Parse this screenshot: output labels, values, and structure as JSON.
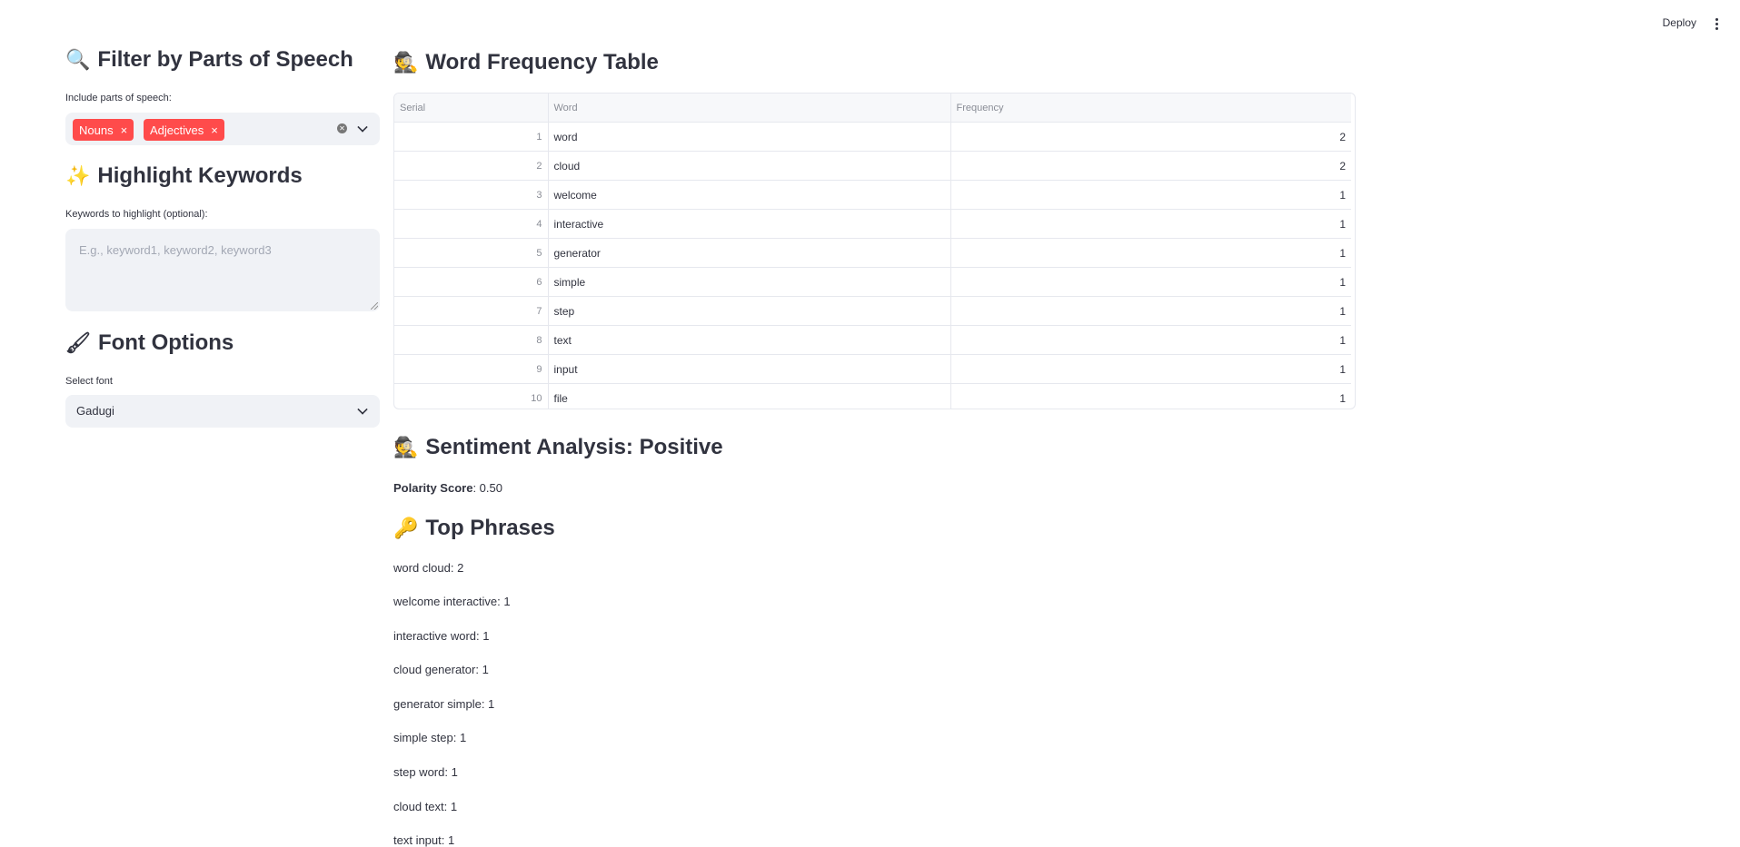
{
  "toolbar": {
    "deploy_label": "Deploy"
  },
  "sidebar": {
    "pos_section": {
      "emoji": "🔍",
      "title": "Filter by Parts of Speech",
      "label": "Include parts of speech:",
      "tags": [
        "Nouns",
        "Adjectives"
      ],
      "tag_remove_glyph": "×"
    },
    "highlight_section": {
      "emoji": "✨",
      "title": "Highlight Keywords",
      "label": "Keywords to highlight (optional):",
      "placeholder": "E.g., keyword1, keyword2, keyword3"
    },
    "font_section": {
      "emoji": "🖌",
      "title": "Font Options",
      "label": "Select font",
      "selected": "Gadugi"
    }
  },
  "main": {
    "table_section": {
      "emoji": "🕵",
      "title": "Word Frequency Table",
      "columns": [
        "Serial",
        "Word",
        "Frequency"
      ],
      "rows": [
        {
          "serial": "1",
          "word": "word",
          "frequency": "2"
        },
        {
          "serial": "2",
          "word": "cloud",
          "frequency": "2"
        },
        {
          "serial": "3",
          "word": "welcome",
          "frequency": "1"
        },
        {
          "serial": "4",
          "word": "interactive",
          "frequency": "1"
        },
        {
          "serial": "5",
          "word": "generator",
          "frequency": "1"
        },
        {
          "serial": "6",
          "word": "simple",
          "frequency": "1"
        },
        {
          "serial": "7",
          "word": "step",
          "frequency": "1"
        },
        {
          "serial": "8",
          "word": "text",
          "frequency": "1"
        },
        {
          "serial": "9",
          "word": "input",
          "frequency": "1"
        },
        {
          "serial": "10",
          "word": "file",
          "frequency": "1"
        }
      ]
    },
    "sentiment_section": {
      "emoji": "🕵",
      "title": "Sentiment Analysis: Positive",
      "polarity_label": "Polarity Score",
      "polarity_value": ": 0.50"
    },
    "phrases_section": {
      "emoji": "🔑",
      "title": "Top Phrases",
      "phrases": [
        "word cloud: 2",
        "welcome interactive: 1",
        "interactive word: 1",
        "cloud generator: 1",
        "generator simple: 1",
        "simple step: 1",
        "step word: 1",
        "cloud text: 1",
        "text input: 1"
      ]
    }
  }
}
